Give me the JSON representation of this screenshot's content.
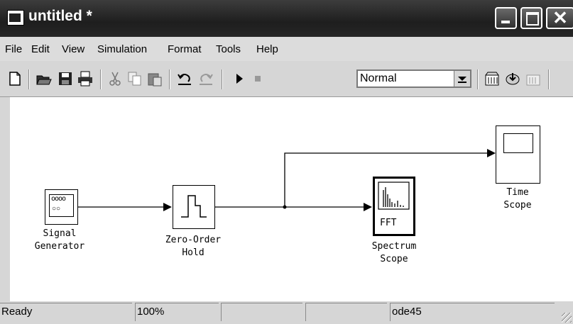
{
  "window": {
    "title": "untitled *"
  },
  "menu": [
    "File",
    "Edit",
    "View",
    "Simulation",
    "Format",
    "Tools",
    "Help"
  ],
  "toolbar": {
    "icons": [
      "new-icon",
      "open-icon",
      "save-icon",
      "print-icon",
      "cut-icon",
      "copy-icon",
      "paste-icon",
      "undo-icon",
      "redo-icon",
      "start-icon",
      "stop-icon",
      "library-icon",
      "build-icon",
      "debug-icon"
    ],
    "mode": "Normal"
  },
  "blocks": {
    "signal_generator": {
      "line1": "Signal",
      "line2": "Generator",
      "icon_text": "oooo"
    },
    "zero_order_hold": {
      "line1": "Zero-Order",
      "line2": "Hold"
    },
    "spectrum_scope": {
      "line1": "Spectrum",
      "line2": "Scope",
      "inner": "FFT"
    },
    "time_scope": {
      "line1": "Time",
      "line2": "Scope"
    }
  },
  "status": {
    "state": "Ready",
    "zoom": "100%",
    "blank1": "",
    "blank2": "",
    "solver": "ode45"
  },
  "colors": {
    "titlebar": "#2a2a2a",
    "chrome": "#d6d6d6",
    "canvas": "#ffffff"
  }
}
